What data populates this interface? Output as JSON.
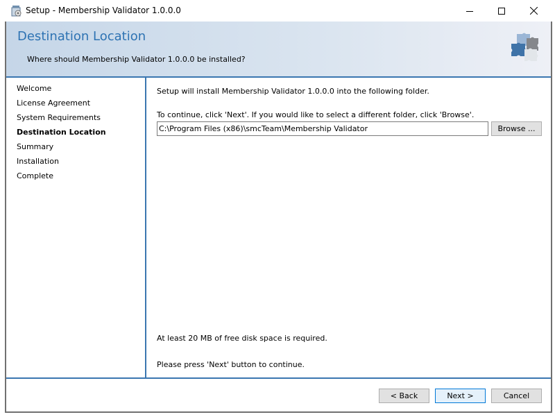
{
  "window": {
    "title": "Setup - Membership Validator 1.0.0.0",
    "icons": [
      "setup-app-icon",
      "minimize-icon",
      "maximize-icon",
      "close-icon"
    ]
  },
  "header": {
    "title": "Destination Location",
    "subtitle": "Where should Membership Validator 1.0.0.0 be installed?",
    "logo_icon": "puzzle-pieces-icon"
  },
  "sidebar": {
    "steps": [
      {
        "label": "Welcome",
        "active": false
      },
      {
        "label": "License Agreement",
        "active": false
      },
      {
        "label": "System Requirements",
        "active": false
      },
      {
        "label": "Destination Location",
        "active": true
      },
      {
        "label": "Summary",
        "active": false
      },
      {
        "label": "Installation",
        "active": false
      },
      {
        "label": "Complete",
        "active": false
      }
    ]
  },
  "content": {
    "intro": "Setup will install Membership Validator 1.0.0.0 into the following folder.",
    "instruction": "To continue, click 'Next'. If you would like to select a different folder, click 'Browse'.",
    "path_value": "C:\\Program Files (x86)\\smcTeam\\Membership Validator",
    "browse_label": "Browse ...",
    "disk_space": "At least 20 MB of free disk space is required.",
    "continue_hint": "Please press 'Next' button to continue."
  },
  "footer": {
    "back_label": "< Back",
    "next_label": "Next >",
    "cancel_label": "Cancel"
  },
  "colors": {
    "accent": "#2e73b3",
    "divider": "#3a76b0",
    "header_gradient_start": "#c5d6e8",
    "header_gradient_end": "#eef0f6"
  }
}
